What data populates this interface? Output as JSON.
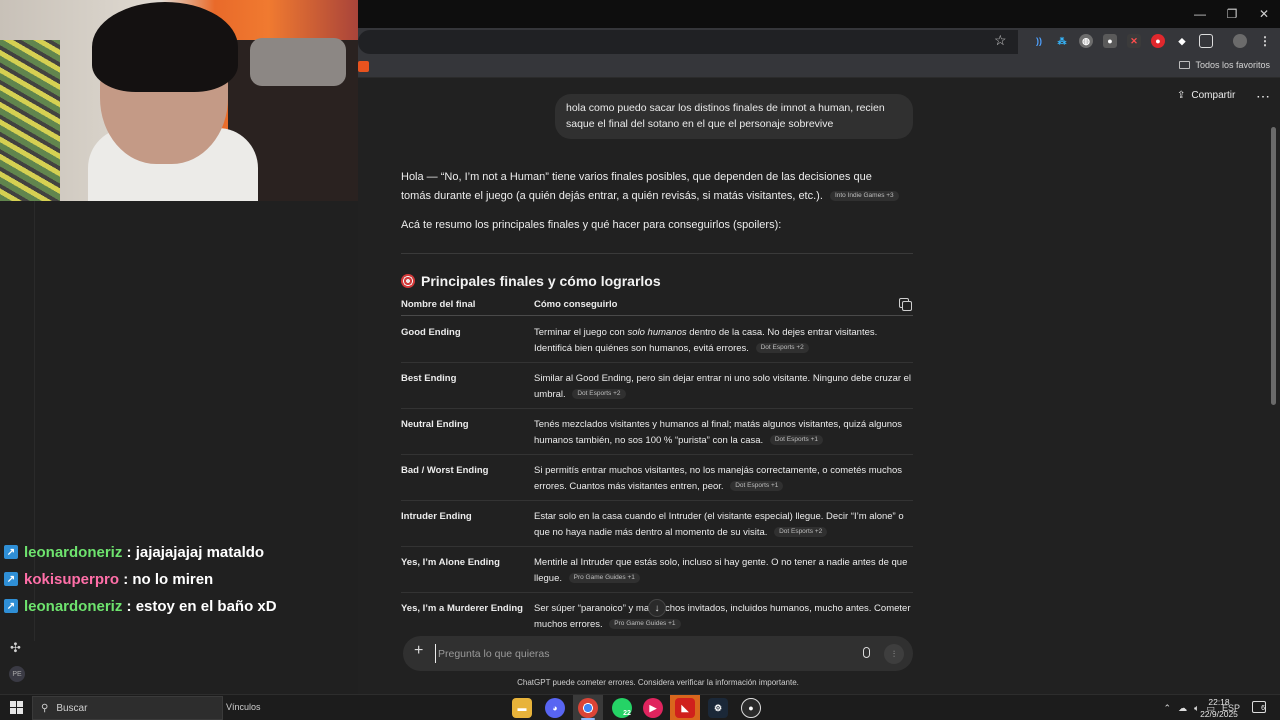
{
  "browser": {
    "bookmarks": {
      "all_bookmarks_label": "Todos los favoritos"
    },
    "window_controls": [
      "—",
      "❐",
      "✕"
    ]
  },
  "stream": {
    "chat": [
      {
        "user": "leonardoneriz",
        "color": "#6ee36e",
        "message": "jajajajajaj mataldo"
      },
      {
        "user": "kokisuperpro",
        "color": "#ff6fa8",
        "message": "no lo miren"
      },
      {
        "user": "leonardoneriz",
        "color": "#6ee36e",
        "message": "estoy en el baño xD"
      }
    ],
    "avatar_initials": "PE"
  },
  "header": {
    "share_label": "Compartir"
  },
  "conversation": {
    "user_message": "hola como puedo sacar los distinos finales de imnot a human, recien saque el final del sotano en el que el personaje sobrevive",
    "intro_p1": "Hola — “No, I’m not a Human” tiene varios finales posibles, que dependen de las decisiones que tomás durante el juego (a quién dejás entrar, a quién revisás, si matás visitantes, etc.).",
    "intro_p1_source": "Into Indie Games +3",
    "intro_p2": "Acá te resumo los principales finales y qué hacer para conseguirlos (spoilers):",
    "section_title": "Principales finales y cómo lograrlos",
    "table": {
      "headers": [
        "Nombre del final",
        "Cómo conseguirlo"
      ],
      "rows": [
        {
          "name": "Good Ending",
          "desc_pre": "Terminar el juego con ",
          "desc_em": "solo humanos",
          "desc_post": " dentro de la casa. No dejes entrar visitantes. Identificá bien quiénes son humanos, evitá errores.",
          "source": "Dot Esports +2"
        },
        {
          "name": "Best Ending",
          "desc_pre": "Similar al Good Ending, pero sin dejar entrar ni uno solo visitante. Ninguno debe cruzar el umbral.",
          "desc_em": "",
          "desc_post": "",
          "source": "Dot Esports +2"
        },
        {
          "name": "Neutral Ending",
          "desc_pre": "Tenés mezclados visitantes y humanos al final; matás algunos visitantes, quizá algunos humanos también, no sos 100 % “purista” con la casa.",
          "desc_em": "",
          "desc_post": "",
          "source": "Dot Esports +1"
        },
        {
          "name": "Bad / Worst Ending",
          "desc_pre": "Si permitís entrar muchos visitantes, no los manejás correctamente, o cometés muchos errores. Cuantos más visitantes entren, peor.",
          "desc_em": "",
          "desc_post": "",
          "source": "Dot Esports +1"
        },
        {
          "name": "Intruder Ending",
          "desc_pre": "Estar solo en la casa cuando el Intruder (el visitante especial) llegue. Decir “I’m alone” o que no haya nadie más dentro al momento de su visita.",
          "desc_em": "",
          "desc_post": "",
          "source": "Dot Esports +2"
        },
        {
          "name": "Yes, I’m Alone Ending",
          "desc_pre": "Mentirle al Intruder que estás solo, incluso si hay gente. O no tener a nadie antes de que llegue.",
          "desc_em": "",
          "desc_post": "",
          "source": "Pro Game Guides +1"
        },
        {
          "name": "Yes, I’m a Murderer Ending",
          "desc_pre": "Ser súper “paranoico” y ma     muchos invitados, incluidos humanos, mucho antes. Cometer muchos errores.",
          "desc_em": "",
          "desc_post": "",
          "source": "Pro Game Guides +1"
        }
      ]
    }
  },
  "composer": {
    "placeholder": "Pregunta lo que quieras",
    "disclaimer": "ChatGPT puede cometer errores. Considera verificar la información importante."
  },
  "taskbar": {
    "search_label": "Buscar",
    "links_label": "Vínculos",
    "whatsapp_badge": "22",
    "lang": "ESP",
    "time": "22:18",
    "date": "22/9/2025",
    "notifications": "6"
  },
  "colors": {
    "background": "#212121",
    "bubble": "#303030",
    "accent_link": "#8ab4f8"
  }
}
